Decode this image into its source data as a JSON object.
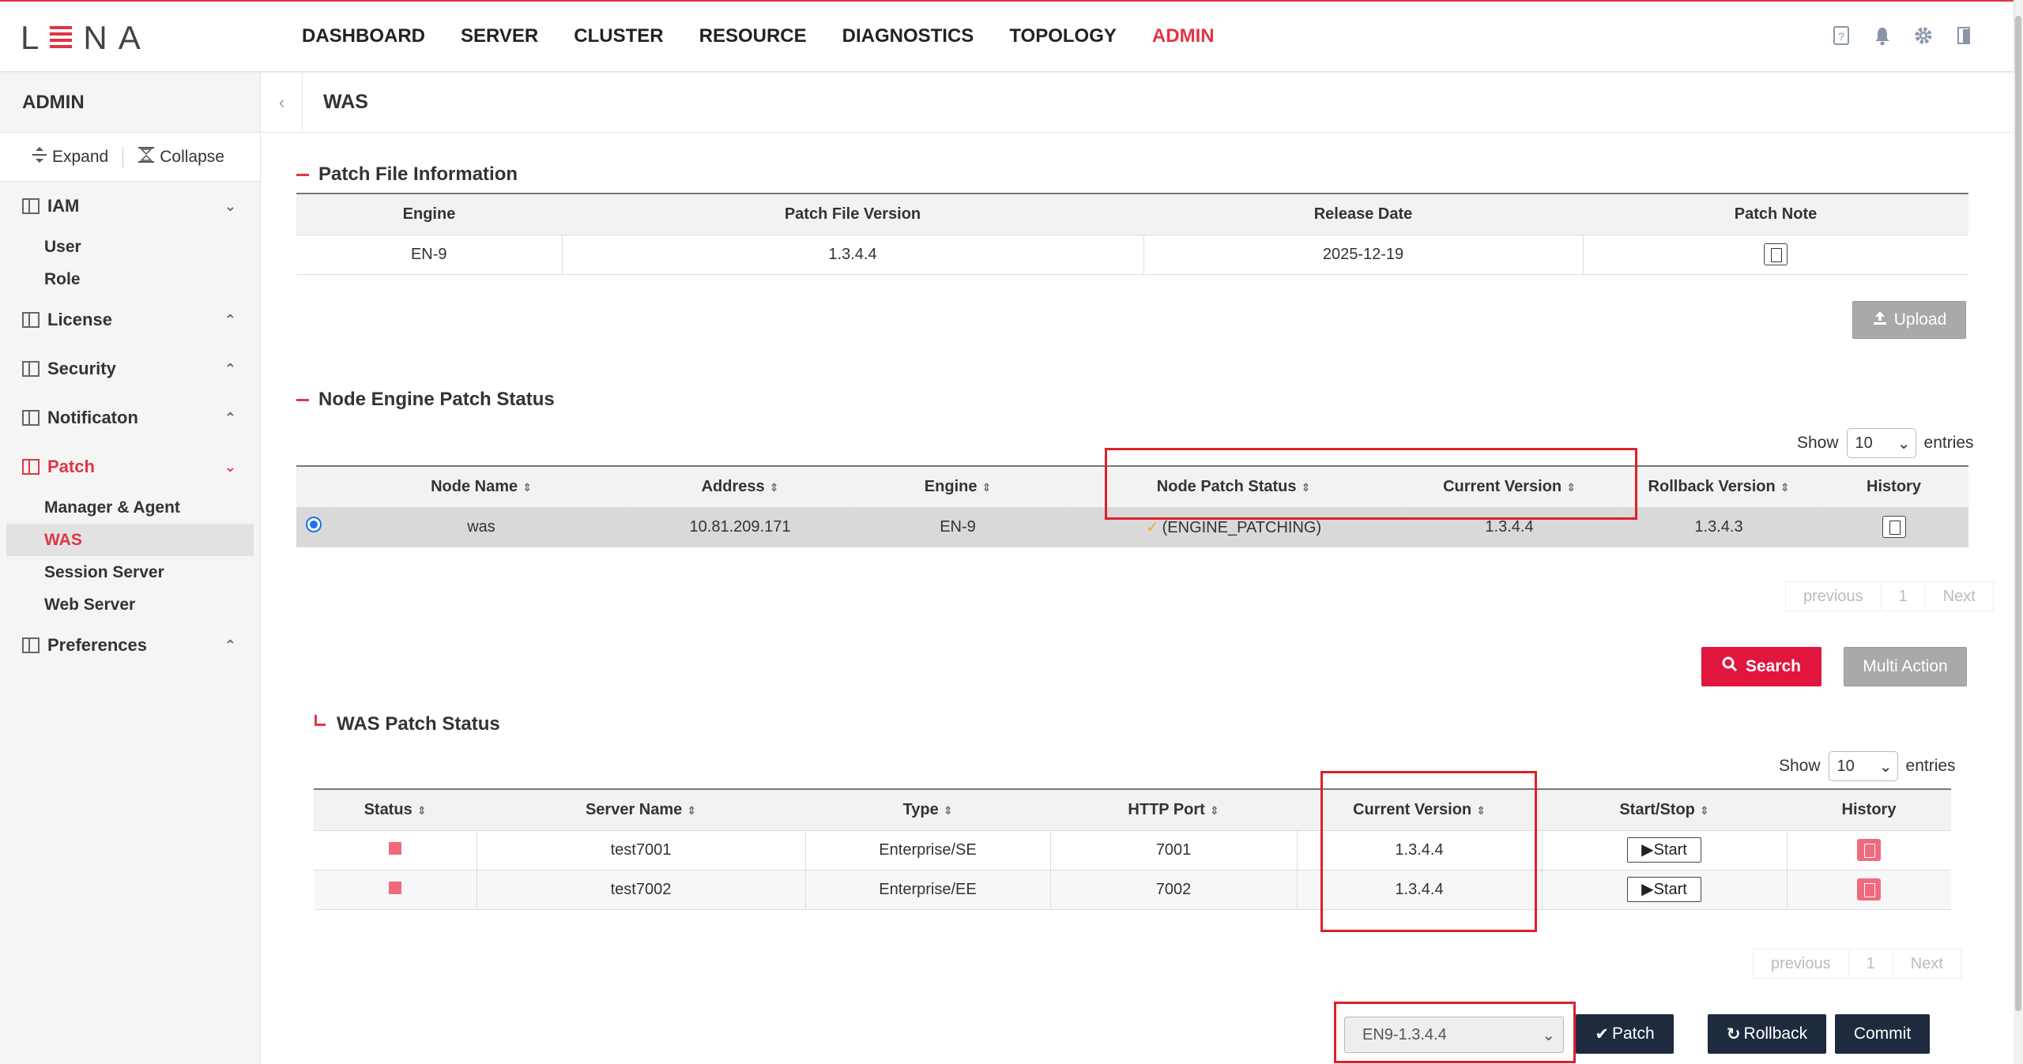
{
  "app": {
    "logo_first": "L",
    "logo_rest": "NA",
    "accent_color": "#e03545"
  },
  "nav": {
    "items": [
      {
        "label": "DASHBOARD"
      },
      {
        "label": "SERVER"
      },
      {
        "label": "CLUSTER"
      },
      {
        "label": "RESOURCE"
      },
      {
        "label": "DIAGNOSTICS"
      },
      {
        "label": "TOPOLOGY"
      },
      {
        "label": "ADMIN",
        "active": true
      }
    ],
    "icons": [
      "help-icon",
      "bell-icon",
      "gear-icon",
      "logout-icon"
    ]
  },
  "sidebar": {
    "title": "ADMIN",
    "expand_label": "Expand",
    "collapse_label": "Collapse",
    "groups": [
      {
        "label": "IAM",
        "open": true,
        "items": [
          "User",
          "Role"
        ]
      },
      {
        "label": "License",
        "open": false,
        "items": []
      },
      {
        "label": "Security",
        "open": false,
        "items": []
      },
      {
        "label": "Notificaton",
        "open": false,
        "items": []
      },
      {
        "label": "Patch",
        "open": true,
        "active": true,
        "items": [
          "Manager & Agent",
          "WAS",
          "Session Server",
          "Web Server"
        ],
        "active_item": "WAS"
      },
      {
        "label": "Preferences",
        "open": false,
        "items": []
      }
    ]
  },
  "page": {
    "title": "WAS"
  },
  "patch_file": {
    "title": "Patch File Information",
    "columns": [
      "Engine",
      "Patch File Version",
      "Release Date",
      "Patch Note"
    ],
    "row": {
      "engine": "EN-9",
      "version": "1.3.4.4",
      "release_date": "2025-12-19"
    },
    "upload_label": "Upload"
  },
  "node_status": {
    "title": "Node Engine Patch Status",
    "show_label": "Show",
    "entries_value": "10",
    "entries_label": "entries",
    "columns": [
      "Node Name",
      "Address",
      "Engine",
      "Node Patch Status",
      "Current Version",
      "Rollback Version",
      "History"
    ],
    "rows": [
      {
        "node": "was",
        "address": "10.81.209.171",
        "engine": "EN-9",
        "status": "(ENGINE_PATCHING)",
        "current": "1.3.4.4",
        "rollback": "1.3.4.3"
      }
    ],
    "pager": {
      "previous": "previous",
      "page": "1",
      "next": "Next"
    },
    "search_label": "Search",
    "multi_action_label": "Multi Action"
  },
  "was_status": {
    "title": "WAS Patch Status",
    "show_label": "Show",
    "entries_value": "10",
    "entries_label": "entries",
    "columns": [
      "Status",
      "Server Name",
      "Type",
      "HTTP Port",
      "Current Version",
      "Start/Stop",
      "History"
    ],
    "rows": [
      {
        "server": "test7001",
        "type": "Enterprise/SE",
        "port": "7001",
        "current": "1.3.4.4",
        "action": "Start"
      },
      {
        "server": "test7002",
        "type": "Enterprise/EE",
        "port": "7002",
        "current": "1.3.4.4",
        "action": "Start"
      }
    ],
    "pager": {
      "previous": "previous",
      "page": "1",
      "next": "Next"
    }
  },
  "actions": {
    "version_select": "EN9-1.3.4.4",
    "patch_label": "Patch",
    "rollback_label": "Rollback",
    "commit_label": "Commit"
  }
}
